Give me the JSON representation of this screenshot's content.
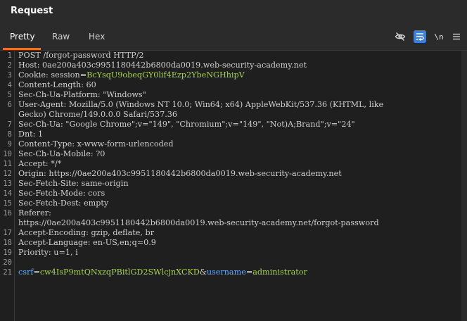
{
  "panel": {
    "title": "Request"
  },
  "tabs": [
    {
      "label": "Pretty",
      "active": true
    },
    {
      "label": "Raw",
      "active": false
    },
    {
      "label": "Hex",
      "active": false
    }
  ],
  "toolbar": {
    "icons": [
      "eye-slash-icon",
      "wrap-lines-icon",
      "newline-toggle-icon",
      "menu-icon"
    ],
    "newline_label": "\\n"
  },
  "colors": {
    "accent": "#e8722a",
    "active_tool": "#3f7fd6",
    "param_green": "#a6d15a",
    "param_blue": "#68a8ff"
  },
  "request": {
    "line_numbers": [
      "1",
      "2",
      "3",
      "4",
      "5",
      "6",
      "7",
      "8",
      "9",
      "10",
      "11",
      "12",
      "13",
      "14",
      "15",
      "16",
      "17",
      "18",
      "19",
      "20",
      "21"
    ],
    "request_line": "POST /forgot-password HTTP/2",
    "headers": {
      "host_key": "Host:",
      "host_val": " 0ae200a403c9951180442b6800da0019.web-security-academy.net",
      "cookie_key": "Cookie:",
      "cookie_name": " session",
      "cookie_eq": "=",
      "cookie_val": "BcYsqU9obeqGY0lif4Ezp2YbeNGHhipV",
      "content_length_key": "Content-Length:",
      "content_length_val": " 60",
      "platform_key": "Sec-Ch-Ua-Platform:",
      "platform_val": " \"Windows\"",
      "ua_key": "User-Agent:",
      "ua_val_1": " Mozilla/5.0 (Windows NT 10.0; Win64; x64) AppleWebKit/537.36 (KHTML, like",
      "ua_val_2": "Gecko) Chrome/149.0.0.0 Safari/537.36",
      "secchua_key": "Sec-Ch-Ua:",
      "secchua_val": " \"Google Chrome\";v=\"149\", \"Chromium\";v=\"149\", \"Not)A;Brand\";v=\"24\"",
      "dnt_key": "Dnt:",
      "dnt_val": " 1",
      "ctype_key": "Content-Type:",
      "ctype_val": " x-www-form-urlencoded",
      "mobile_key": "Sec-Ch-Ua-Mobile:",
      "mobile_val": " ?0",
      "accept_key": "Accept:",
      "accept_val": " */*",
      "origin_key": "Origin:",
      "origin_val": " https://0ae200a403c9951180442b6800da0019.web-security-academy.net",
      "site_key": "Sec-Fetch-Site:",
      "site_val": " same-origin",
      "mode_key": "Sec-Fetch-Mode:",
      "mode_val": " cors",
      "dest_key": "Sec-Fetch-Dest:",
      "dest_val": " empty",
      "referer_key": "Referer:",
      "referer_val": "https://0ae200a403c9951180442b6800da0019.web-security-academy.net/forgot-password",
      "encoding_key": "Accept-Encoding:",
      "encoding_val": " gzip, deflate, br",
      "lang_key": "Accept-Language:",
      "lang_val": " en-US,en;q=0.9",
      "priority_key": "Priority:",
      "priority_val": " u=1, i"
    },
    "body": {
      "csrf_name": "csrf",
      "eq1": "=",
      "csrf_val": "cw4IsP9mtQNxzqPBitlGD2SWlcjnXCKD",
      "amp": "&",
      "user_name": "username",
      "eq2": "=",
      "user_val": "administrator"
    }
  }
}
